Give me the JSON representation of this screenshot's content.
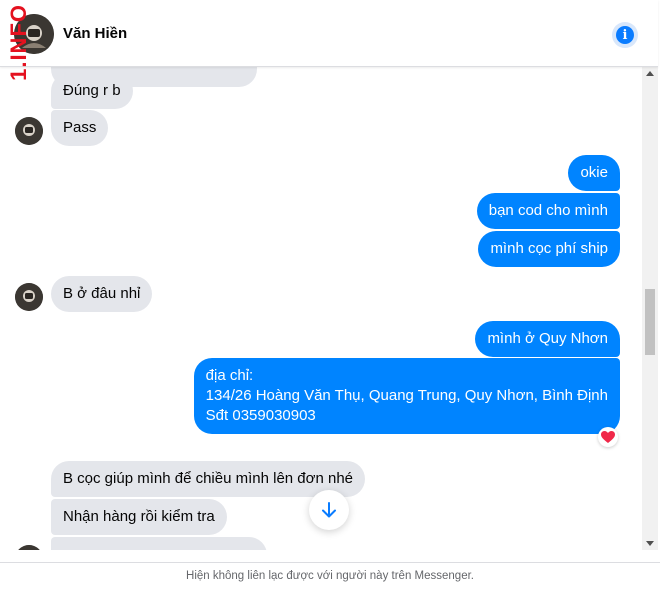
{
  "header": {
    "contact_name": "Văn Hiền",
    "info_icon": "info-icon"
  },
  "watermark": "1.INFO",
  "messages": [
    {
      "side": "in",
      "text": "Đúng r b"
    },
    {
      "side": "in",
      "text": "Pass"
    },
    {
      "side": "out",
      "text": "okie"
    },
    {
      "side": "out",
      "text": "bạn cod cho mình"
    },
    {
      "side": "out",
      "text": "mình cọc phí ship"
    },
    {
      "side": "in",
      "text": "B ở đâu nhỉ"
    },
    {
      "side": "out",
      "text": "mình ở Quy Nhơn"
    },
    {
      "side": "out",
      "lines": [
        "địa chỉ:",
        "134/26 Hoàng Văn Thụ, Quang Trung, Quy Nhơn, Bình Định",
        "Sđt 0359030903"
      ],
      "reaction": "heart-icon"
    },
    {
      "side": "in",
      "text": "B cọc giúp mình để chiều mình lên đơn nhé"
    },
    {
      "side": "in",
      "text": "Nhận hàng rồi kiểm tra"
    }
  ],
  "footer": {
    "notice": "Hiện không liên lạc được với người này trên Messenger."
  },
  "colors": {
    "outgoing": "#0084ff",
    "incoming": "#e4e6eb",
    "accent": "#0a7cff",
    "watermark": "#e4111f"
  }
}
